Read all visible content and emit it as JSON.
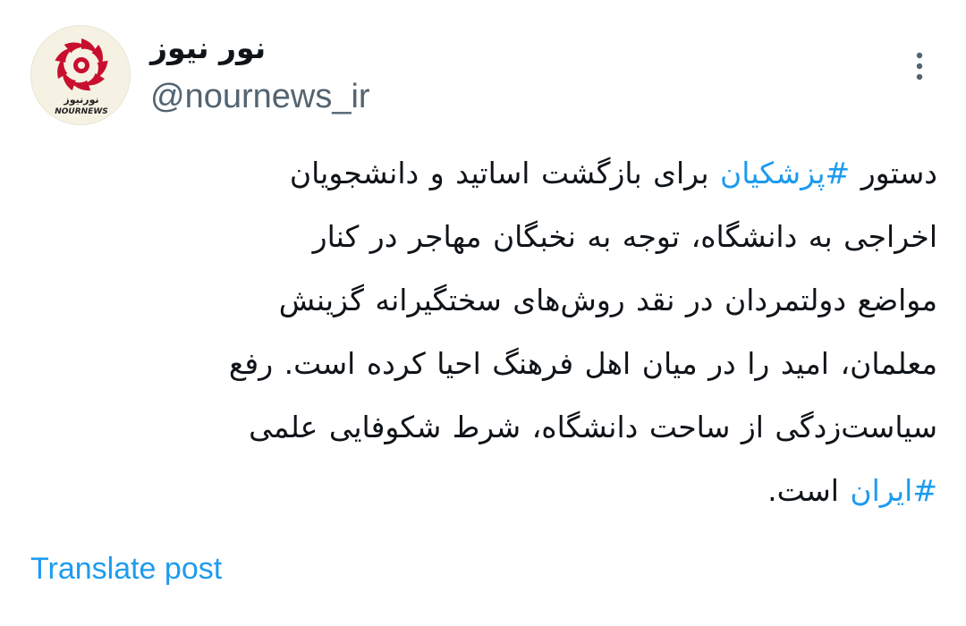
{
  "colors": {
    "text": "#0f1419",
    "secondary": "#536471",
    "link": "#1d9bf0",
    "logo_red": "#c8102e"
  },
  "author": {
    "display_name": "نور نیوز",
    "handle": "@nournews_ir",
    "avatar_logo_text": "نورنیوز",
    "avatar_logo_subtext": "NOURNEWS"
  },
  "more_icon": "more-vertical-icon",
  "post": {
    "line1": {
      "pre": "دستور ",
      "hashtag": "#پزشکیان",
      "post": " برای بازگشت اساتید و دانشجویان"
    },
    "line2": "اخراجی به دانشگاه، توجه به نخبگان مهاجر در کنار",
    "line3": "مواضع دولتمردان در نقد روش‌های سختگیرانه گزینش",
    "line4": "معلمان، امید را در میان اهل فرهنگ احیا کرده است. رفع",
    "line5": "سیاست‌زدگی از ساحت دانشگاه، شرط شکوفایی علمی",
    "line6": {
      "hashtag": "#ایران",
      "post": " است."
    }
  },
  "translate_label": "Translate post"
}
